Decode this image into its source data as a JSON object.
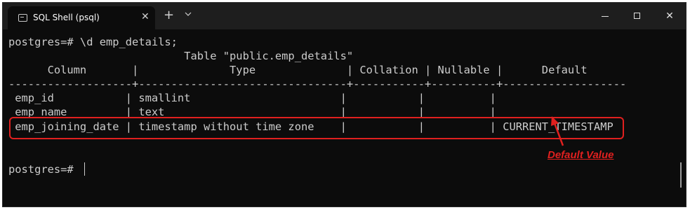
{
  "window": {
    "tab_title": "SQL Shell (psql)",
    "tab_close": "✕",
    "new_tab": "+",
    "tab_dropdown": "⌄",
    "close_glyph": "✕"
  },
  "terminal": {
    "lines": [
      "postgres=# \\d emp_details;",
      "                           Table \"public.emp_details\"",
      "      Column       |              Type              | Collation | Nullable |      Default",
      "-------------------+--------------------------------+-----------+----------+-------------------",
      " emp_id           | smallint                       |           |          |",
      " emp_name         | text                           |           |          |",
      " emp_joining_date | timestamp without time zone    |           |          | CURRENT_TIMESTAMP",
      "",
      "",
      "postgres=# "
    ]
  },
  "annotation": {
    "label": "Default Value",
    "color": "#e0201f"
  }
}
